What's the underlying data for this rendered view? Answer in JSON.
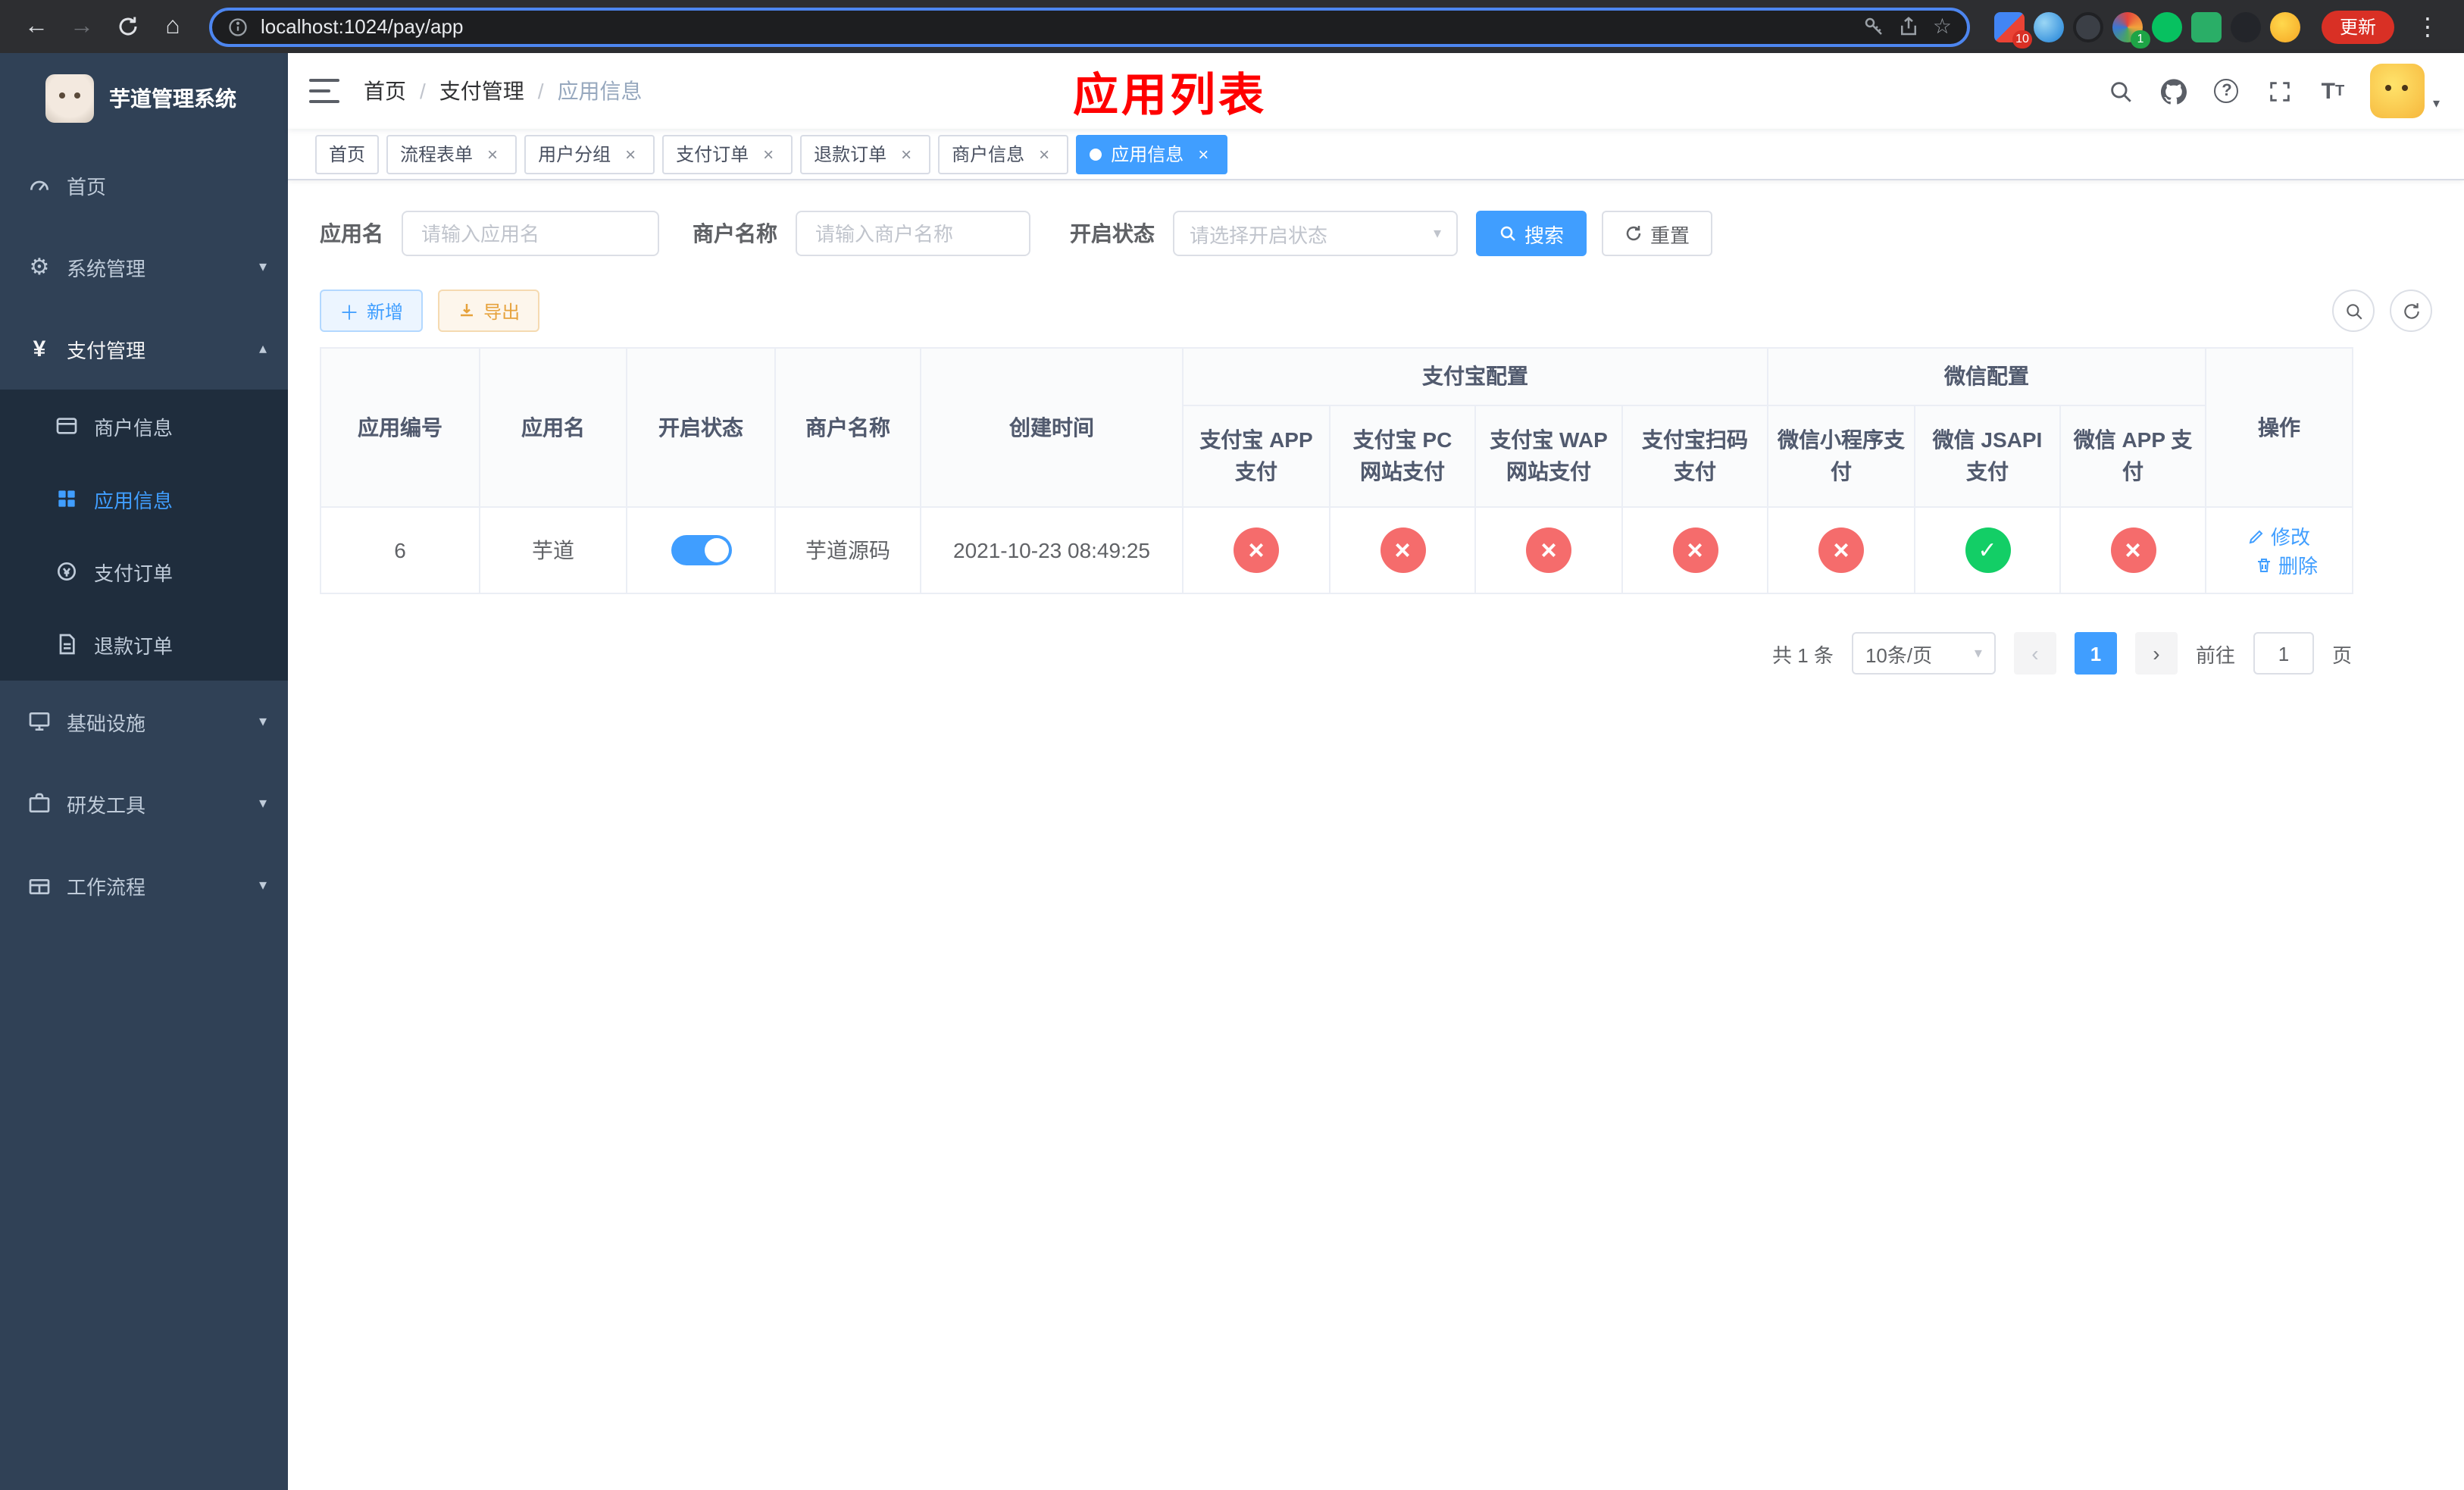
{
  "browser": {
    "url": "localhost:1024/pay/app",
    "update_label": "更新",
    "ext_badge_grid": "10",
    "ext_badge_rings": "1"
  },
  "sidebar": {
    "title": "芋道管理系统",
    "menu": [
      {
        "label": "首页"
      },
      {
        "label": "系统管理"
      },
      {
        "label": "支付管理",
        "children": [
          {
            "label": "商户信息"
          },
          {
            "label": "应用信息"
          },
          {
            "label": "支付订单"
          },
          {
            "label": "退款订单"
          }
        ]
      },
      {
        "label": "基础设施"
      },
      {
        "label": "研发工具"
      },
      {
        "label": "工作流程"
      }
    ]
  },
  "header": {
    "breadcrumb": [
      "首页",
      "支付管理",
      "应用信息"
    ],
    "annotation": "应用列表"
  },
  "tabs": {
    "items": [
      {
        "label": "首页"
      },
      {
        "label": "流程表单"
      },
      {
        "label": "用户分组"
      },
      {
        "label": "支付订单"
      },
      {
        "label": "退款订单"
      },
      {
        "label": "商户信息"
      },
      {
        "label": "应用信息"
      }
    ]
  },
  "filters": {
    "app_name_label": "应用名",
    "app_name_placeholder": "请输入应用名",
    "merchant_label": "商户名称",
    "merchant_placeholder": "请输入商户名称",
    "status_label": "开启状态",
    "status_placeholder": "请选择开启状态",
    "search_label": "搜索",
    "reset_label": "重置"
  },
  "toolbar": {
    "add_label": "新增",
    "export_label": "导出"
  },
  "table": {
    "group_headers": {
      "alipay": "支付宝配置",
      "wechat": "微信配置"
    },
    "columns": [
      "应用编号",
      "应用名",
      "开启状态",
      "商户名称",
      "创建时间",
      "支付宝 APP 支付",
      "支付宝 PC 网站支付",
      "支付宝 WAP 网站支付",
      "支付宝扫码支付",
      "微信小程序支付",
      "微信 JSAPI 支付",
      "微信 APP 支付",
      "操作"
    ],
    "rows": [
      {
        "id": "6",
        "name": "芋道",
        "enabled": "on",
        "merchant": "芋道源码",
        "created_at": "2021-10-23 08:49:25",
        "statuses": [
          "fail",
          "fail",
          "fail",
          "fail",
          "fail",
          "pass",
          "fail"
        ],
        "edit_label": "修改",
        "delete_label": "删除"
      }
    ]
  },
  "pagination": {
    "total": "共 1 条",
    "page_size": "10条/页",
    "current_page": "1",
    "goto_prefix": "前往",
    "goto_value": "1",
    "goto_suffix": "页"
  },
  "colors": {
    "accent": "#409eff",
    "danger": "#f56c6c",
    "success": "#13ce66",
    "warning": "#e6a23c",
    "annotation": "#ff0000"
  }
}
